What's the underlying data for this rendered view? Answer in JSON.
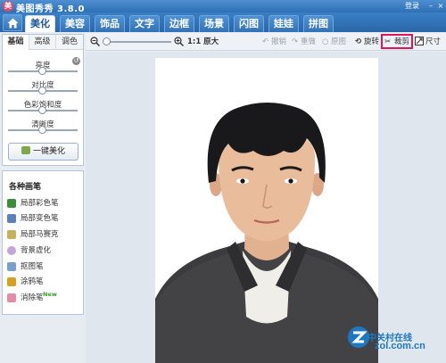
{
  "app": {
    "title": "美图秀秀 3.8.0",
    "logo_icon": "meitu-logo-icon",
    "login_label": "登录"
  },
  "tabs": [
    {
      "label": "美化",
      "active": true
    },
    {
      "label": "美容"
    },
    {
      "label": "饰品"
    },
    {
      "label": "文字"
    },
    {
      "label": "边框"
    },
    {
      "label": "场景"
    },
    {
      "label": "闪图"
    },
    {
      "label": "娃娃"
    },
    {
      "label": "拼图"
    }
  ],
  "left_panel": {
    "subtabs": [
      {
        "label": "基础",
        "active": true
      },
      {
        "label": "高级"
      },
      {
        "label": "调色"
      }
    ],
    "adjustments": [
      {
        "label": "亮度"
      },
      {
        "label": "对比度"
      },
      {
        "label": "色彩饱和度"
      },
      {
        "label": "清晰度"
      }
    ],
    "one_key_button": "一键美化"
  },
  "brush_panel": {
    "title": "各种画笔",
    "items": [
      {
        "label": "局部彩色笔",
        "icon": "color-brush-icon",
        "color": "#3a8f3a"
      },
      {
        "label": "局部变色笔",
        "icon": "recolor-brush-icon",
        "color": "#5b7fb8"
      },
      {
        "label": "局部马赛克",
        "icon": "mosaic-icon",
        "color": "#c8b060"
      },
      {
        "label": "背景虚化",
        "icon": "blur-icon",
        "color": "#c4a3d6"
      },
      {
        "label": "抠图笔",
        "icon": "cutout-icon",
        "color": "#7b9fcc"
      },
      {
        "label": "涂鸦笔",
        "icon": "doodle-icon",
        "color": "#d9a020"
      },
      {
        "label": "消除笔",
        "icon": "eraser-icon",
        "color": "#e98aa8",
        "badge": "New"
      }
    ]
  },
  "toolbar": {
    "actual_size_label": "1:1 原大",
    "undo_label": "撤销",
    "redo_label": "重做",
    "original_label": "原图",
    "rotate_label": "旋转",
    "crop_label": "裁剪",
    "size_label": "尺寸"
  },
  "watermark": {
    "cn": "中关村在线",
    "en": "zol.com.cn"
  }
}
